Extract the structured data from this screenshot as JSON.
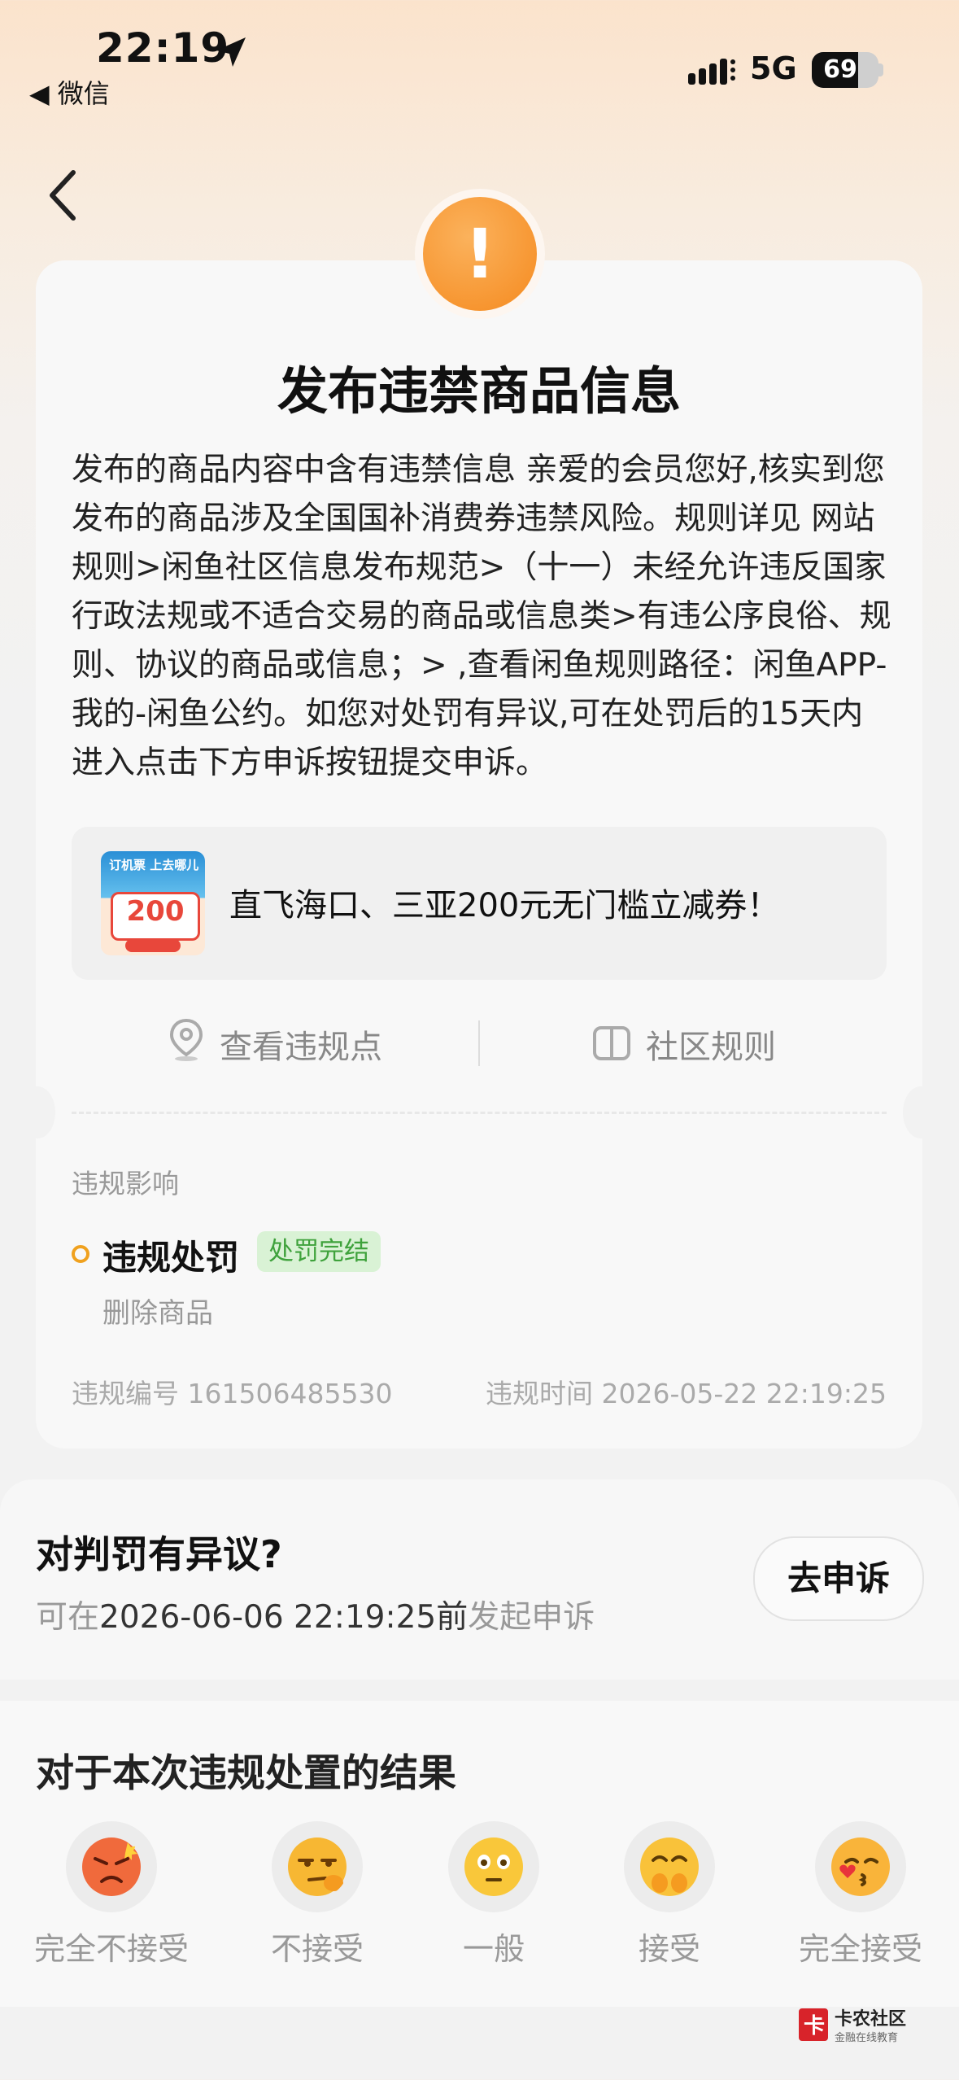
{
  "status_bar": {
    "time": "22:19",
    "back_app": "◀ 微信",
    "network": "5G",
    "battery": "69"
  },
  "violation": {
    "title": "发布违禁商品信息",
    "description": "发布的商品内容中含有违禁信息 亲爱的会员您好,核实到您发布的商品涉及全国国补消费券违禁风险。规则详见 网站规则>闲鱼社区信息发布规范>（十一）未经允许违反国家行政法规或不适合交易的商品或信息类>有违公序良俗、规则、协议的商品或信息；> ,查看闲鱼规则路径：闲鱼APP-我的-闲鱼公约。如您对处罚有异议,可在处罚后的15天内进入点击下方申诉按钮提交申诉。",
    "promo": {
      "text": "直飞海口、三亚200元无门槛立减券！",
      "image_top_text": "订机票 上去哪儿",
      "image_value": "200"
    },
    "actions": {
      "view_points": "查看违规点",
      "community_rules": "社区规则"
    },
    "impact": {
      "label": "违规影响",
      "penalty_title": "违规处罚",
      "penalty_status": "处罚完结",
      "penalty_detail": "删除商品"
    },
    "meta": {
      "id_label": "违规编号",
      "id_value": "161506485530",
      "time_label": "违规时间",
      "time_value": "2026-05-22 22:19:25"
    }
  },
  "dispute": {
    "title": "对判罚有异议?",
    "prefix": "可在",
    "deadline": "2026-06-06 22:19:25前",
    "suffix": "发起申诉",
    "button": "去申诉"
  },
  "feedback": {
    "title": "对于本次违规处置的结果",
    "options": [
      {
        "label": "完全不接受",
        "icon": "angry-face-icon",
        "color": "#f06a3c"
      },
      {
        "label": "不接受",
        "icon": "unamused-face-icon",
        "color": "#f7b733"
      },
      {
        "label": "一般",
        "icon": "neutral-face-icon",
        "color": "#f9c73a"
      },
      {
        "label": "接受",
        "icon": "happy-face-icon",
        "color": "#f9c23a"
      },
      {
        "label": "完全接受",
        "icon": "kiss-face-icon",
        "color": "#f9b43a"
      }
    ]
  },
  "watermark": {
    "name": "卡农社区",
    "sub": "金融在线教育"
  },
  "colors": {
    "accent_orange": "#f58a1f",
    "badge_green": "#3fa23c"
  }
}
